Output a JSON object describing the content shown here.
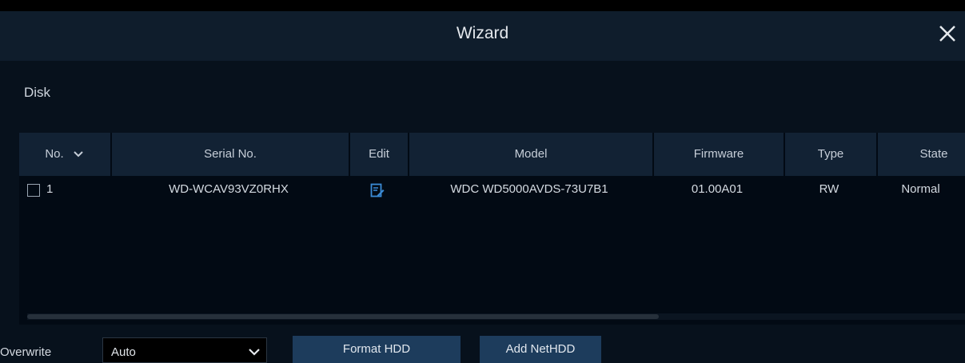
{
  "dialog": {
    "title": "Wizard",
    "close_icon": "close-icon"
  },
  "section": {
    "title": "Disk"
  },
  "table": {
    "columns": [
      "No.",
      "Serial No.",
      "Edit",
      "Model",
      "Firmware",
      "Type",
      "State"
    ],
    "sort_icon": "chevron-down-icon",
    "rows": [
      {
        "no": "1",
        "serial": "WD-WCAV93VZ0RHX",
        "edit_icon": "edit-icon",
        "model": "WDC WD5000AVDS-73U7B1",
        "firmware": "01.00A01",
        "type": "RW",
        "state": "Normal"
      }
    ]
  },
  "footer": {
    "overwrite_label": "Overwrite",
    "overwrite_value": "Auto",
    "format_button": "Format HDD",
    "add_button": "Add NetHDD"
  },
  "colors": {
    "titlebar": "#0f1d2c",
    "panel": "#07111c",
    "header": "#122234",
    "button": "#1d3c5c",
    "edit_icon": "#3b8bd6"
  }
}
